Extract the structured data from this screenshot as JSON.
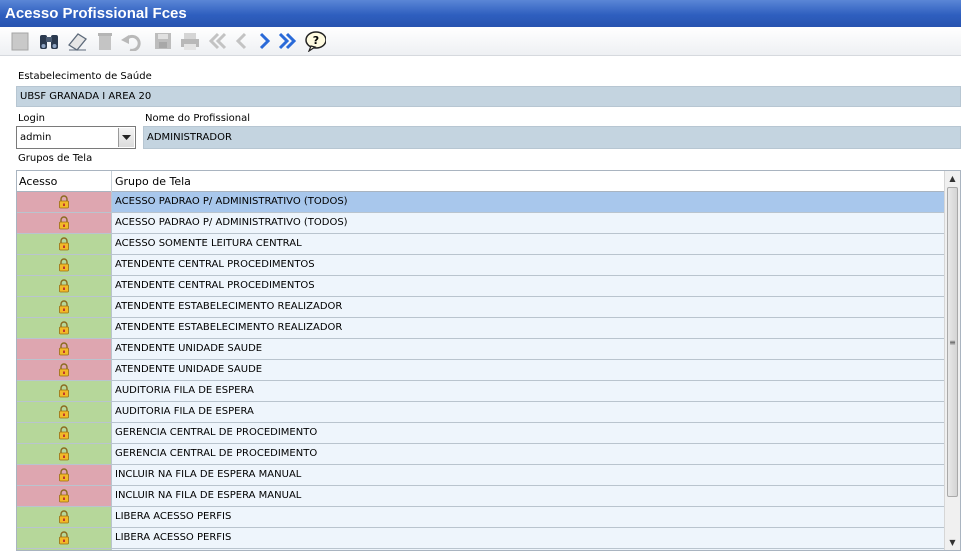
{
  "window": {
    "title": "Acesso Profissional Fces"
  },
  "toolbar": {
    "icons": [
      "new-icon",
      "search-binoculars-icon",
      "eraser-icon",
      "trash-icon",
      "undo-icon",
      "save-icon",
      "print-icon",
      "first-icon",
      "previous-icon",
      "next-icon",
      "last-icon",
      "help-icon"
    ]
  },
  "form": {
    "estabelecimento_label": "Estabelecimento de Saúde",
    "estabelecimento_value": "UBSF GRANADA I AREA 20",
    "login_label": "Login",
    "login_value": "admin",
    "nome_label": "Nome do Profissional",
    "nome_value": "ADMINISTRADOR",
    "grupos_label": "Grupos de Tela"
  },
  "grid": {
    "headers": {
      "acesso": "Acesso",
      "grupo": "Grupo de Tela"
    },
    "rows": [
      {
        "grupo": "ACESSO PADRAO P/ ADMINISTRATIVO (TODOS)",
        "status": "off",
        "selected": true
      },
      {
        "grupo": "ACESSO PADRAO P/ ADMINISTRATIVO (TODOS)",
        "status": "off",
        "selected": false
      },
      {
        "grupo": "ACESSO SOMENTE LEITURA CENTRAL",
        "status": "on",
        "selected": false
      },
      {
        "grupo": "ATENDENTE CENTRAL PROCEDIMENTOS",
        "status": "on",
        "selected": false
      },
      {
        "grupo": "ATENDENTE CENTRAL PROCEDIMENTOS",
        "status": "on",
        "selected": false
      },
      {
        "grupo": "ATENDENTE ESTABELECIMENTO REALIZADOR",
        "status": "on",
        "selected": false
      },
      {
        "grupo": "ATENDENTE ESTABELECIMENTO REALIZADOR",
        "status": "on",
        "selected": false
      },
      {
        "grupo": "ATENDENTE UNIDADE SAUDE",
        "status": "off",
        "selected": false
      },
      {
        "grupo": "ATENDENTE UNIDADE SAUDE",
        "status": "off",
        "selected": false
      },
      {
        "grupo": "AUDITORIA FILA DE ESPERA",
        "status": "on",
        "selected": false
      },
      {
        "grupo": "AUDITORIA FILA DE ESPERA",
        "status": "on",
        "selected": false
      },
      {
        "grupo": "GERENCIA CENTRAL DE PROCEDIMENTO",
        "status": "on",
        "selected": false
      },
      {
        "grupo": "GERENCIA CENTRAL DE PROCEDIMENTO",
        "status": "on",
        "selected": false
      },
      {
        "grupo": "INCLUIR NA FILA DE ESPERA MANUAL",
        "status": "off",
        "selected": false
      },
      {
        "grupo": "INCLUIR NA FILA DE ESPERA MANUAL",
        "status": "off",
        "selected": false
      },
      {
        "grupo": "LIBERA ACESSO PERFIS",
        "status": "on",
        "selected": false
      },
      {
        "grupo": "LIBERA ACESSO PERFIS",
        "status": "on",
        "selected": false
      },
      {
        "grupo": "",
        "status": "on",
        "selected": false
      }
    ]
  },
  "colors": {
    "title_bar": "#2f5fbf",
    "access_on": "#b6d79a",
    "access_off": "#dea6b0",
    "selected_row": "#a8c7ec",
    "row_bg": "#eef5fc",
    "field_bg": "#c4d4e0"
  }
}
